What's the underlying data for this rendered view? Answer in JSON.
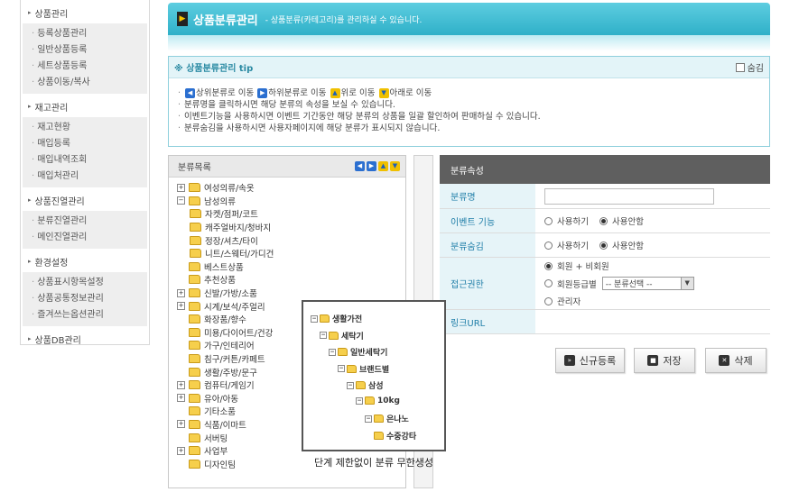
{
  "sidebar": {
    "groups": [
      {
        "title": "상품관리",
        "items": [
          "등록상품관리",
          "일반상품등록",
          "세트상품등록",
          "상품이동/복사"
        ]
      },
      {
        "title": "재고관리",
        "items": [
          "재고현황",
          "매입등록",
          "매입내역조회",
          "매입처관리"
        ]
      },
      {
        "title": "상품진열관리",
        "items": [
          "분류진열관리",
          "메인진열관리"
        ]
      },
      {
        "title": "환경설정",
        "items": [
          "상품표시항목설정",
          "상품공통정보관리",
          "즐겨쓰는옵션관리"
        ]
      },
      {
        "title": "상품DB관리",
        "items": []
      }
    ]
  },
  "header": {
    "title": "상품분류관리",
    "subtitle": "- 상품분류(카테고리)를 관리하실 수 있습니다."
  },
  "tip": {
    "title": "※ 상품분류관리 tip",
    "hide_label": "숨김",
    "line1": {
      "a": "상위분류로 이동",
      "b": "하위분류로 이동",
      "c": "위로 이동",
      "d": "아래로 이동"
    },
    "line2": "분류명을 클릭하시면 해당 분류의 속성을 보실 수 있습니다.",
    "line3": "이벤트기능을 사용하시면 이벤트 기간동안 해당 분류의 상품을 일괄 할인하여 판매하실 수 있습니다.",
    "line4": "분류숨김을 사용하시면 사용자페이지에 해당 분류가 표시되지 않습니다."
  },
  "tree": {
    "title": "분류목록",
    "nodes": [
      {
        "label": "여성의류/속옷",
        "toggle": "+",
        "level": 0
      },
      {
        "label": "남성의류",
        "toggle": "-",
        "level": 0
      },
      {
        "label": "자켓/점퍼/코트",
        "toggle": "",
        "level": 1
      },
      {
        "label": "캐주얼바지/청바지",
        "toggle": "",
        "level": 1
      },
      {
        "label": "정장/셔츠/타이",
        "toggle": "",
        "level": 1
      },
      {
        "label": "니트/스웨터/가디건",
        "toggle": "",
        "level": 1
      },
      {
        "label": "베스트상품",
        "toggle": "",
        "level": 0
      },
      {
        "label": "추천상품",
        "toggle": "",
        "level": 0
      },
      {
        "label": "신발/가방/소품",
        "toggle": "+",
        "level": 0
      },
      {
        "label": "시계/보석/주얼리",
        "toggle": "+",
        "level": 0
      },
      {
        "label": "화장품/향수",
        "toggle": "",
        "level": 0
      },
      {
        "label": "미용/다이어트/건강",
        "toggle": "",
        "level": 0
      },
      {
        "label": "가구/인테리어",
        "toggle": "",
        "level": 0
      },
      {
        "label": "침구/커튼/카페트",
        "toggle": "",
        "level": 0
      },
      {
        "label": "생활/주방/문구",
        "toggle": "",
        "level": 0
      },
      {
        "label": "컴퓨터/게임기",
        "toggle": "+",
        "level": 0
      },
      {
        "label": "유아/아동",
        "toggle": "+",
        "level": 0
      },
      {
        "label": "기타소품",
        "toggle": "",
        "level": 0
      },
      {
        "label": "식품/이마트",
        "toggle": "+",
        "level": 0
      },
      {
        "label": "서버팅",
        "toggle": "",
        "level": 0
      },
      {
        "label": "사업부",
        "toggle": "+",
        "level": 0
      },
      {
        "label": "디자인팀",
        "toggle": "",
        "level": 0
      }
    ]
  },
  "props": {
    "title": "분류속성",
    "name_label": "분류명",
    "name_value": "",
    "event_label": "이벤트 기능",
    "hide_label": "분류숨김",
    "use": "사용하기",
    "nouse": "사용안함",
    "access_label": "접근권한",
    "access_opt1": "회원 + 비회원",
    "access_opt2": "회원등급별",
    "access_select": "-- 분류선택 --",
    "access_opt3": "관리자",
    "link_label": "링크URL",
    "link_value": ""
  },
  "buttons": {
    "new": "신규등록",
    "save": "저장",
    "delete": "삭제"
  },
  "callout": {
    "nodes": [
      "생활가전",
      "세탁기",
      "일반세탁기",
      "브랜드별",
      "삼성",
      "10kg",
      "은나노",
      "수중강타"
    ],
    "caption": "단계 제한없이 분류 무한생성"
  }
}
